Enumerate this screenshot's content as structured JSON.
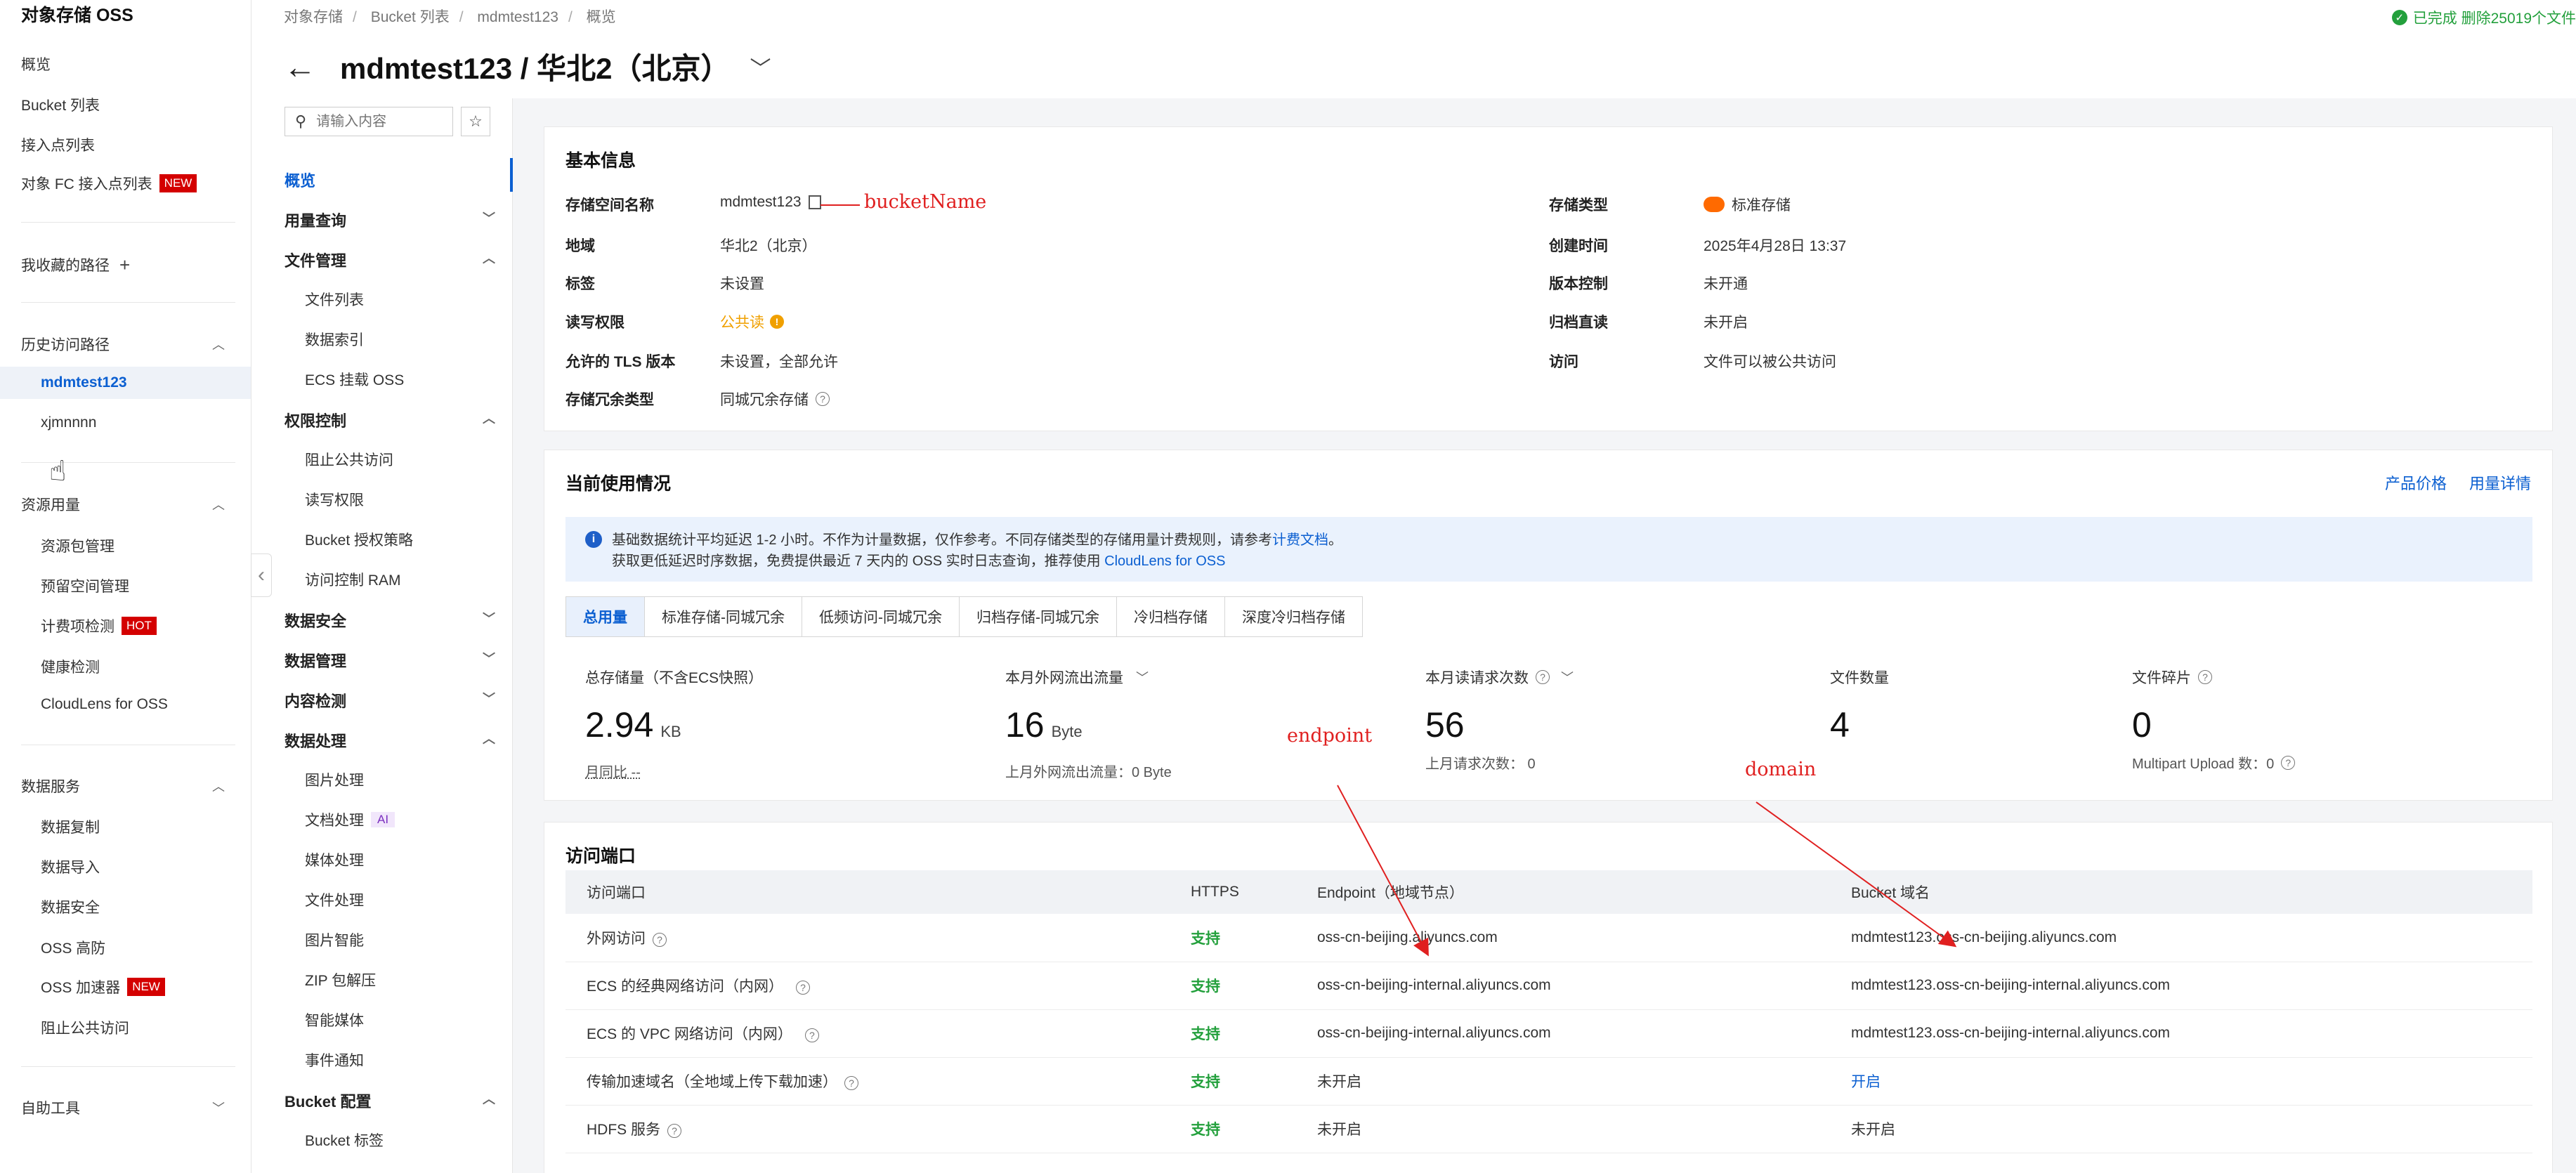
{
  "sidebar": {
    "brand": "对象存储 OSS",
    "top_items": [
      "概览",
      "Bucket 列表",
      "接入点列表",
      "对象 FC 接入点列表"
    ],
    "new_badge": "NEW",
    "hot_badge": "HOT",
    "favorites": "我收藏的路径",
    "history": {
      "title": "历史访问路径",
      "items": [
        "mdmtest123",
        "xjmnnnn"
      ]
    },
    "resources": {
      "title": "资源用量",
      "items": [
        "资源包管理",
        "预留空间管理",
        "计费项检测",
        "健康检测",
        "CloudLens for OSS"
      ]
    },
    "data_services": {
      "title": "数据服务",
      "items": [
        "数据复制",
        "数据导入",
        "数据安全",
        "OSS 高防",
        "OSS 加速器",
        "阻止公共访问"
      ]
    },
    "self_tools": "自助工具"
  },
  "breadcrumb": [
    "对象存储",
    "Bucket 列表",
    "mdmtest123",
    "概览"
  ],
  "header": {
    "title": "mdmtest123 / 华北2（北京）"
  },
  "status": "已完成 删除25019个文件",
  "bucket_menu": {
    "search_placeholder": "请输入内容",
    "overview": "概览",
    "usage": "用量查询",
    "file_mgmt": {
      "title": "文件管理",
      "items": [
        "文件列表",
        "数据索引",
        "ECS 挂载 OSS"
      ]
    },
    "perm": {
      "title": "权限控制",
      "items": [
        "阻止公共访问",
        "读写权限",
        "Bucket 授权策略",
        "访问控制 RAM"
      ]
    },
    "data_security": "数据安全",
    "data_mgmt": "数据管理",
    "content_detect": "内容检测",
    "data_proc": {
      "title": "数据处理",
      "items": [
        "图片处理",
        "文档处理",
        "媒体处理",
        "文件处理",
        "图片智能",
        "ZIP 包解压",
        "智能媒体",
        "事件通知"
      ]
    },
    "ai_badge": "AI",
    "bucket_config": {
      "title": "Bucket 配置",
      "items": [
        "Bucket 标签"
      ]
    }
  },
  "basic_info": {
    "title": "基本信息",
    "left": [
      {
        "label": "存储空间名称",
        "value": "mdmtest123"
      },
      {
        "label": "地域",
        "value": "华北2（北京）"
      },
      {
        "label": "标签",
        "value": "未设置"
      },
      {
        "label": "读写权限",
        "value": "公共读"
      },
      {
        "label": "允许的 TLS 版本",
        "value": "未设置，全部允许"
      },
      {
        "label": "存储冗余类型",
        "value": "同城冗余存储"
      }
    ],
    "right": [
      {
        "label": "存储类型",
        "value": "标准存储"
      },
      {
        "label": "创建时间",
        "value": "2025年4月28日 13:37"
      },
      {
        "label": "版本控制",
        "value": "未开通"
      },
      {
        "label": "归档直读",
        "value": "未开启"
      },
      {
        "label": "访问",
        "value": "文件可以被公共访问"
      }
    ]
  },
  "annotations": {
    "bucket_name": "bucketName",
    "endpoint": "endpoint",
    "domain": "domain"
  },
  "usage": {
    "title": "当前使用情况",
    "links": [
      "产品价格",
      "用量详情"
    ],
    "notice_line1": "基础数据统计平均延迟 1-2 小时。不作为计量数据，仅作参考。不同存储类型的存储用量计费规则，请参考",
    "notice_link1": "计费文档",
    "notice_line1_end": "。",
    "notice_line2": "获取更低延迟时序数据，免费提供最近 7 天内的 OSS 实时日志查询，推荐使用",
    "notice_link2": "CloudLens for OSS",
    "tabs": [
      "总用量",
      "标准存储-同城冗余",
      "低频访问-同城冗余",
      "归档存储-同城冗余",
      "冷归档存储",
      "深度冷归档存储"
    ],
    "stats": [
      {
        "label": "总存储量（不含ECS快照）",
        "value": "2.94",
        "unit": "KB",
        "sub": "月同比 --"
      },
      {
        "label": "本月外网流出流量",
        "value": "16",
        "unit": "Byte",
        "sub": "上月外网流出流量：0 Byte"
      },
      {
        "label": "本月读请求次数",
        "value": "56",
        "unit": "",
        "sub": "上月请求次数：  0"
      },
      {
        "label": "文件数量",
        "value": "4",
        "unit": "",
        "sub": ""
      },
      {
        "label": "文件碎片",
        "value": "0",
        "unit": "",
        "sub": "Multipart Upload 数：0"
      }
    ]
  },
  "access": {
    "title": "访问端口",
    "headers": [
      "访问端口",
      "HTTPS",
      "Endpoint（地域节点）",
      "Bucket 域名"
    ],
    "rows": [
      {
        "name": "外网访问",
        "https": "支持",
        "endpoint": "oss-cn-beijing.aliyuncs.com",
        "domain": "mdmtest123.oss-cn-beijing.aliyuncs.com"
      },
      {
        "name": "ECS 的经典网络访问（内网）",
        "https": "支持",
        "endpoint": "oss-cn-beijing-internal.aliyuncs.com",
        "domain": "mdmtest123.oss-cn-beijing-internal.aliyuncs.com"
      },
      {
        "name": "ECS 的 VPC 网络访问（内网）",
        "https": "支持",
        "endpoint": "oss-cn-beijing-internal.aliyuncs.com",
        "domain": "mdmtest123.oss-cn-beijing-internal.aliyuncs.com"
      },
      {
        "name": "传输加速域名（全地域上传下载加速）",
        "https": "支持",
        "endpoint": "未开启",
        "domain": "开启"
      },
      {
        "name": "HDFS 服务",
        "https": "支持",
        "endpoint": "未开启",
        "domain": "未开启"
      }
    ]
  }
}
